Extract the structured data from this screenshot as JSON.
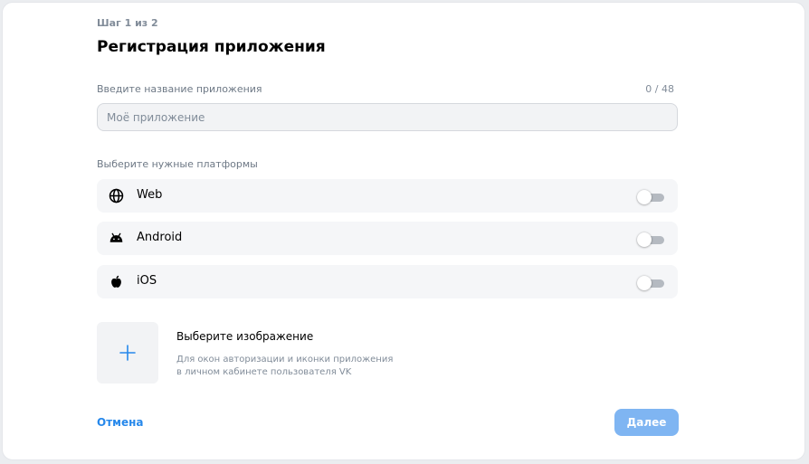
{
  "header": {
    "step": "Шаг 1 из 2",
    "title": "Регистрация приложения"
  },
  "name_field": {
    "label": "Введите название приложения",
    "counter": "0 / 48",
    "value": "",
    "placeholder": "Моё приложение"
  },
  "platforms": {
    "label": "Выберите нужные платформы",
    "items": [
      {
        "name": "Web",
        "icon": "globe-icon",
        "enabled": false
      },
      {
        "name": "Android",
        "icon": "android-icon",
        "enabled": false
      },
      {
        "name": "iOS",
        "icon": "apple-icon",
        "enabled": false
      }
    ]
  },
  "image": {
    "title": "Выберите изображение",
    "description_line1": "Для окон авторизации и иконки приложения",
    "description_line2": "в личном кабинете пользователя VK",
    "icon": "plus-icon"
  },
  "actions": {
    "cancel_label": "Отмена",
    "next_label": "Далее"
  },
  "colors": {
    "accent": "#2688eb",
    "next_button_disabled": "#7fb5f2"
  }
}
